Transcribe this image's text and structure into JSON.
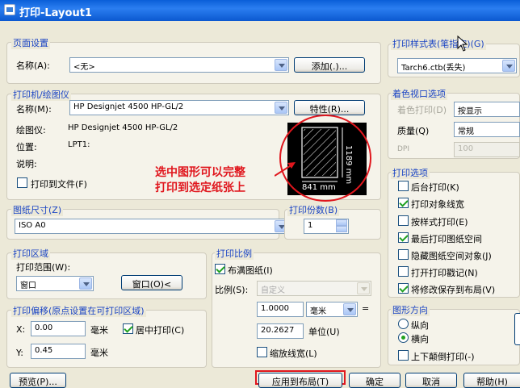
{
  "window": {
    "title": "打印-Layout1"
  },
  "page_setup": {
    "group": "页面设置",
    "name_label": "名称(A):",
    "name_value": "<无>",
    "add_button": "添加(.)..."
  },
  "printer": {
    "group": "打印机/绘图仪",
    "name_label": "名称(M):",
    "name_value": "HP Designjet 4500 HP-GL/2",
    "properties_button": "特性(R)...",
    "plotter_label": "绘图仪:",
    "plotter_value": "HP Designjet 4500 HP-GL/2",
    "location_label": "位置:",
    "location_value": "LPT1:",
    "description_label": "说明:",
    "print_to_file": "打印到文件(F)",
    "print_to_file_checked": false
  },
  "preview": {
    "width_dim": "841 mm",
    "height_dim": "1189 mm"
  },
  "annotation": {
    "line1": "选中图形可以完整",
    "line2": "打印到选定纸张上",
    "color": "#e0161d"
  },
  "paper_size": {
    "group": "图纸尺寸(Z)",
    "value": "ISO A0"
  },
  "copies": {
    "group": "打印份数(B)",
    "value": "1"
  },
  "plot_area": {
    "group": "打印区域",
    "range_label": "打印范围(W):",
    "range_value": "窗口",
    "window_button": "窗口(O)<"
  },
  "plot_scale": {
    "group": "打印比例",
    "fit_to_paper": "布满图纸(I)",
    "fit_to_paper_checked": true,
    "scale_label": "比例(S):",
    "scale_value": "自定义",
    "value1": "1.0000",
    "unit1": "毫米",
    "equals": "=",
    "value2": "20.2627",
    "unit2_label": "单位(U)",
    "scale_lineweights": "缩放线宽(L)",
    "scale_lineweights_checked": false
  },
  "plot_offset": {
    "group": "打印偏移(原点设置在可打印区域)",
    "x_label": "X:",
    "x_value": "0.00",
    "x_unit": "毫米",
    "center": "居中打印(C)",
    "center_checked": true,
    "y_label": "Y:",
    "y_value": "0.45",
    "y_unit": "毫米"
  },
  "plot_style": {
    "group": "打印样式表(笔指定)(G)",
    "value": "Tarch6.ctb(丢失)"
  },
  "shaded_viewport": {
    "group": "着色视口选项",
    "shade_label": "着色打印(D)",
    "shade_value": "按显示",
    "quality_label": "质量(Q)",
    "quality_value": "常规",
    "dpi_label": "DPI",
    "dpi_value": "100"
  },
  "plot_options": {
    "group": "打印选项",
    "items": [
      {
        "label": "后台打印(K)",
        "checked": false
      },
      {
        "label": "打印对象线宽",
        "checked": true
      },
      {
        "label": "按样式打印(E)",
        "checked": false
      },
      {
        "label": "最后打印图纸空间",
        "checked": true
      },
      {
        "label": "隐藏图纸空间对象(J)",
        "checked": false
      },
      {
        "label": "打开打印戳记(N)",
        "checked": false
      },
      {
        "label": "将修改保存到布局(V)",
        "checked": true
      }
    ]
  },
  "orientation": {
    "group": "图形方向",
    "portrait": "纵向",
    "landscape": "横向",
    "selected": "landscape",
    "upside_down": "上下颠倒打印(-)",
    "upside_down_checked": false
  },
  "footer": {
    "preview_button": "预览(P)...",
    "apply_button": "应用到布局(T)",
    "ok_button": "确定",
    "cancel_button": "取消",
    "help_button": "帮助(H)"
  }
}
